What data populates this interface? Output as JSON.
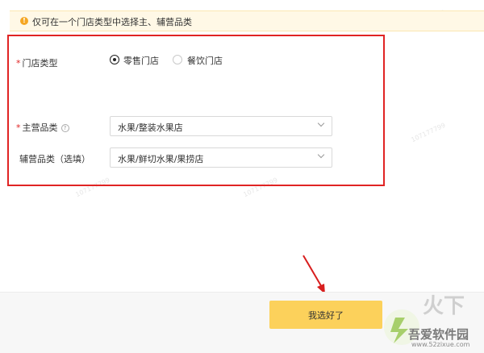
{
  "notice": {
    "icon": "warning-icon",
    "text": "仅可在一个门店类型中选择主、辅营品类"
  },
  "form": {
    "store_type": {
      "required_mark": "*",
      "label": "门店类型",
      "options": [
        {
          "label": "零售门店",
          "selected": true
        },
        {
          "label": "餐饮门店",
          "selected": false
        }
      ]
    },
    "main_category": {
      "required_mark": "*",
      "label": "主营品类",
      "help_icon": "question-circle-icon",
      "value": "水果/整装水果店"
    },
    "sub_category": {
      "label": "辅营品类（选填）",
      "value": "水果/鲜切水果/果捞店"
    }
  },
  "footer": {
    "confirm_label": "我选好了"
  },
  "watermark": {
    "text": "107177799"
  },
  "brand": {
    "name": "吾爱软件园",
    "url": "www.52zixue.com"
  },
  "colors": {
    "accent_button": "#fcd15b",
    "highlight_border": "#e02424",
    "notice_bg": "#fff8e6",
    "warning_icon": "#f5a623"
  }
}
